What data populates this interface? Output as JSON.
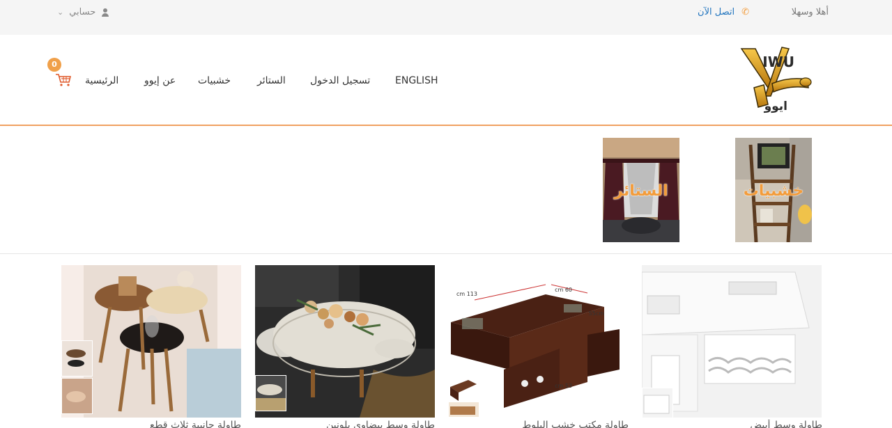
{
  "topbar": {
    "greeting": "أهلا وسهلا",
    "call_label": "اتصل الآن",
    "account_label": "حسابي"
  },
  "header": {
    "logo_text": "IWU",
    "logo_arabic": "ايوو",
    "nav": {
      "english": "ENGLISH",
      "login": "تسجيل الدخول",
      "curtains": "الستائر",
      "woodwork": "خشبيات",
      "about": "عن إيوو",
      "home": "الرئيسية"
    },
    "cart_count": "0"
  },
  "categories": [
    {
      "label": "خشبيات"
    },
    {
      "label": "الستائر"
    }
  ],
  "products": [
    {
      "title": "طاولة وسط أبيض"
    },
    {
      "title": "طاولة مكتب خشب البلوط"
    },
    {
      "title": "طاولة وسط بيضاوي بلونين"
    },
    {
      "title": "طاولة جانبية ثلاث قطع"
    }
  ],
  "colors": {
    "accent": "#f39c3b",
    "link": "#1e73be",
    "topbar_bg": "#f5f5f5"
  }
}
